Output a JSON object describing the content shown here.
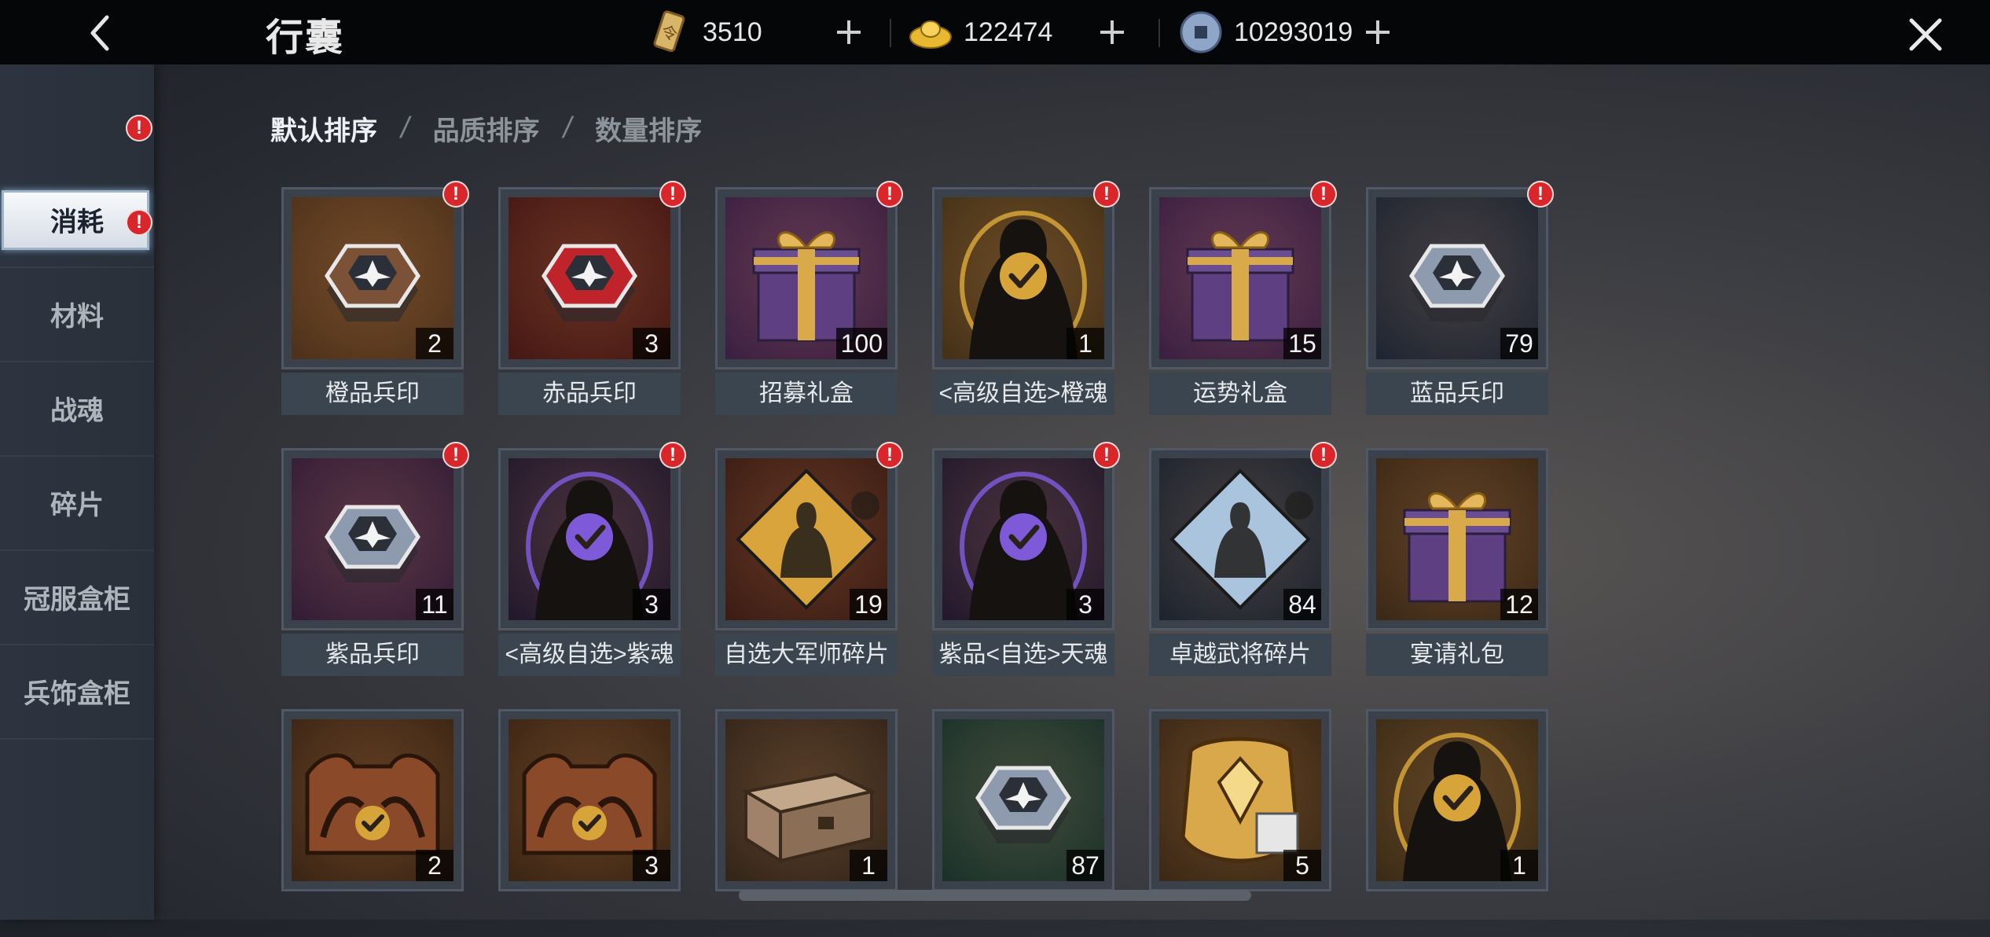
{
  "header": {
    "title": "行囊",
    "currencies": [
      {
        "name": "token-icon",
        "value": "3510"
      },
      {
        "name": "gold-ingot-icon",
        "value": "122474"
      },
      {
        "name": "coin-icon",
        "value": "10293019"
      }
    ]
  },
  "sidebar": {
    "items": [
      {
        "label": "消耗",
        "active": true,
        "badge": true
      },
      {
        "label": "材料",
        "active": false,
        "badge": true
      },
      {
        "label": "战魂",
        "active": false,
        "badge": false
      },
      {
        "label": "碎片",
        "active": false,
        "badge": false
      },
      {
        "label": "冠服盒柜",
        "active": false,
        "badge": false
      },
      {
        "label": "兵饰盒柜",
        "active": false,
        "badge": false
      }
    ]
  },
  "sort": {
    "options": [
      "默认排序",
      "品质排序",
      "数量排序"
    ],
    "active": "默认排序"
  },
  "badge_symbol": "!",
  "items": [
    {
      "name": "橙品兵印",
      "count": "2",
      "badge": true,
      "icon": "seal-box-icon",
      "bg": "#7a4a22",
      "color": "#7b5137"
    },
    {
      "name": "赤品兵印",
      "count": "3",
      "badge": true,
      "icon": "seal-box-icon",
      "bg": "#6a1e18",
      "color": "#c0242b"
    },
    {
      "name": "招募礼盒",
      "count": "100",
      "badge": true,
      "icon": "gift-box-icon",
      "bg": "#5a2a6a",
      "color": "#5d3f82"
    },
    {
      "name": "<高级自选>橙魂",
      "count": "1",
      "badge": true,
      "icon": "silhouette-check-icon",
      "bg": "#6a4a1e",
      "color": "#d7a43a"
    },
    {
      "name": "运势礼盒",
      "count": "15",
      "badge": true,
      "icon": "gift-box-icon",
      "bg": "#5a2a6a",
      "color": "#5d3f82"
    },
    {
      "name": "蓝品兵印",
      "count": "79",
      "badge": true,
      "icon": "seal-box-icon",
      "bg": "#24344f",
      "color": "#8e9aae"
    },
    {
      "name": "紫品兵印",
      "count": "11",
      "badge": true,
      "icon": "seal-box-icon",
      "bg": "#4b2456",
      "color": "#8e9aae"
    },
    {
      "name": "<高级自选>紫魂",
      "count": "3",
      "badge": true,
      "icon": "silhouette-check-icon",
      "bg": "#2c1e44",
      "color": "#7e5ad8"
    },
    {
      "name": "自选大军师碎片",
      "count": "19",
      "badge": true,
      "icon": "puzzle-diamond-icon",
      "bg": "#5a2418",
      "color": "#d9a43c"
    },
    {
      "name": "紫品<自选>天魂",
      "count": "3",
      "badge": true,
      "icon": "silhouette-check-icon",
      "bg": "#2c1e44",
      "color": "#7e5ad8"
    },
    {
      "name": "卓越武将碎片",
      "count": "84",
      "badge": true,
      "icon": "puzzle-diamond-icon",
      "bg": "#233348",
      "color": "#a9c4dc"
    },
    {
      "name": "宴请礼包",
      "count": "12",
      "badge": false,
      "icon": "gift-box-icon",
      "bg": "#5a3a1e",
      "color": "#5d3f82"
    },
    {
      "name": "",
      "count": "2",
      "badge": false,
      "icon": "beast-plaque-check-icon",
      "bg": "#5a3418",
      "color": "#8a4a2a"
    },
    {
      "name": "",
      "count": "3",
      "badge": false,
      "icon": "beast-plaque-check-icon",
      "bg": "#5a3418",
      "color": "#8a4a2a"
    },
    {
      "name": "",
      "count": "1",
      "badge": false,
      "icon": "chest-icon",
      "bg": "#4a3422",
      "color": "#a0826a"
    },
    {
      "name": "",
      "count": "87",
      "badge": false,
      "icon": "seal-box-icon",
      "bg": "#1e4a40",
      "color": "#8e9aae"
    },
    {
      "name": "",
      "count": "5",
      "badge": false,
      "icon": "golden-armor-icon",
      "bg": "#5a3a1a",
      "color": "#d8a84a"
    },
    {
      "name": "",
      "count": "1",
      "badge": false,
      "icon": "silhouette-check-icon",
      "bg": "#5a401c",
      "color": "#d7a43a"
    }
  ]
}
